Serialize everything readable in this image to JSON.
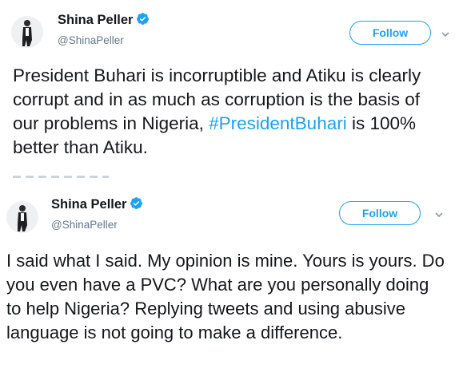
{
  "tweets": [
    {
      "author_name": "Shina Peller",
      "author_handle": "@ShinaPeller",
      "follow_label": "Follow",
      "text_before": "President Buhari is incorruptible and Atiku is clearly corrupt and in as much as corruption is the basis of our problems in Nigeria, ",
      "hashtag": "#PresidentBuhari",
      "text_after": " is 100% better than Atiku."
    },
    {
      "author_name": "Shina Peller",
      "author_handle": "@ShinaPeller",
      "follow_label": "Follow",
      "text": "I said what I said. My opinion is mine. Yours is yours. Do you even have a PVC? What are you personally doing to help Nigeria? Replying tweets and using abusive language is not going to make a difference."
    }
  ],
  "colors": {
    "accent": "#1da1f2",
    "text": "#14171a",
    "muted": "#657786"
  },
  "icons": [
    "verified-badge-icon",
    "chevron-down-icon",
    "avatar"
  ]
}
